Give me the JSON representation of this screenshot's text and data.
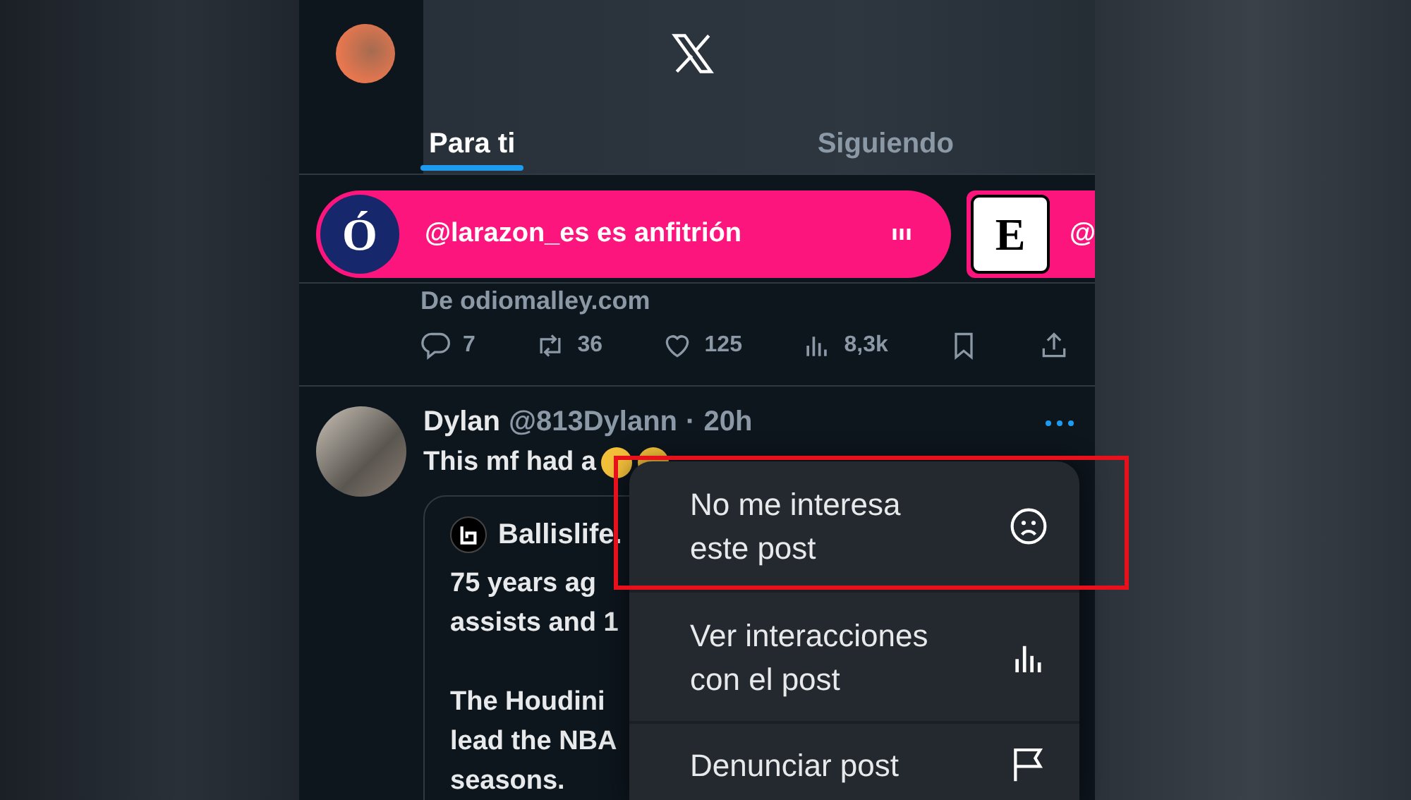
{
  "header": {
    "tabs": [
      {
        "label": "Para ti",
        "selected": true
      },
      {
        "label": "Siguiendo",
        "selected": false
      }
    ]
  },
  "spaces": [
    {
      "logo": "Ó",
      "host": "@larazon_es es anfitrión"
    },
    {
      "logo": "E",
      "host": "@"
    }
  ],
  "previous_post": {
    "link_source": "De odiomalley.com",
    "actions": [
      {
        "kind": "reply",
        "count": "7"
      },
      {
        "kind": "repost",
        "count": "36"
      },
      {
        "kind": "like",
        "count": "125"
      },
      {
        "kind": "views",
        "count": "8,3k"
      },
      {
        "kind": "bookmark"
      },
      {
        "kind": "share"
      }
    ]
  },
  "post": {
    "name": "Dylan",
    "handle": "@813Dylann",
    "separator": "·",
    "time": "20h",
    "text": "This mf had a",
    "quote": {
      "name": "Ballislife.",
      "paragraphs": [
        "75 years ag\nassists and 1",
        "The Houdini\nlead the NBA\nseasons."
      ]
    }
  },
  "menu": {
    "items": [
      {
        "kind": "not-interested",
        "label": "No me interesa\neste post",
        "highlighted": true
      },
      {
        "kind": "interactions",
        "label": "Ver interacciones\ncon el post",
        "highlighted": false
      },
      {
        "kind": "report",
        "label": "Denunciar post",
        "highlighted": false
      }
    ]
  }
}
